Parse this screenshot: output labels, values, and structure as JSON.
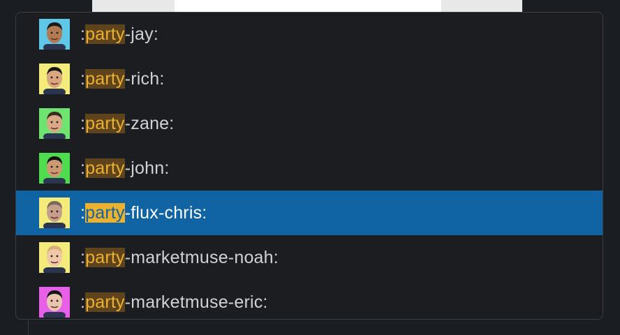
{
  "autocomplete": {
    "query": "party",
    "items": [
      {
        "prefix": ":",
        "match": "party",
        "suffix": "-jay:",
        "avatar_bg": "#5ec8e6",
        "selected": false
      },
      {
        "prefix": ":",
        "match": "party",
        "suffix": "-rich:",
        "avatar_bg": "#f3ec7a",
        "selected": false
      },
      {
        "prefix": ":",
        "match": "party",
        "suffix": "-zane:",
        "avatar_bg": "#6fe36f",
        "selected": false
      },
      {
        "prefix": ":",
        "match": "party",
        "suffix": "-john:",
        "avatar_bg": "#4fdc4f",
        "selected": false
      },
      {
        "prefix": ":",
        "match": "party",
        "suffix": "-flux-chris:",
        "avatar_bg": "#f3ec7a",
        "selected": true
      },
      {
        "prefix": ":",
        "match": "party",
        "suffix": "-marketmuse-noah:",
        "avatar_bg": "#f3ec7a",
        "selected": false
      },
      {
        "prefix": ":",
        "match": "party",
        "suffix": "-marketmuse-eric:",
        "avatar_bg": "#e85fe8",
        "selected": false
      }
    ]
  },
  "colors": {
    "selected_bg": "#1164a3",
    "highlight_bg": "#5e431d",
    "highlight_text": "#ecb22e",
    "text": "#d1d2d3",
    "popup_bg": "#1b1d21"
  }
}
